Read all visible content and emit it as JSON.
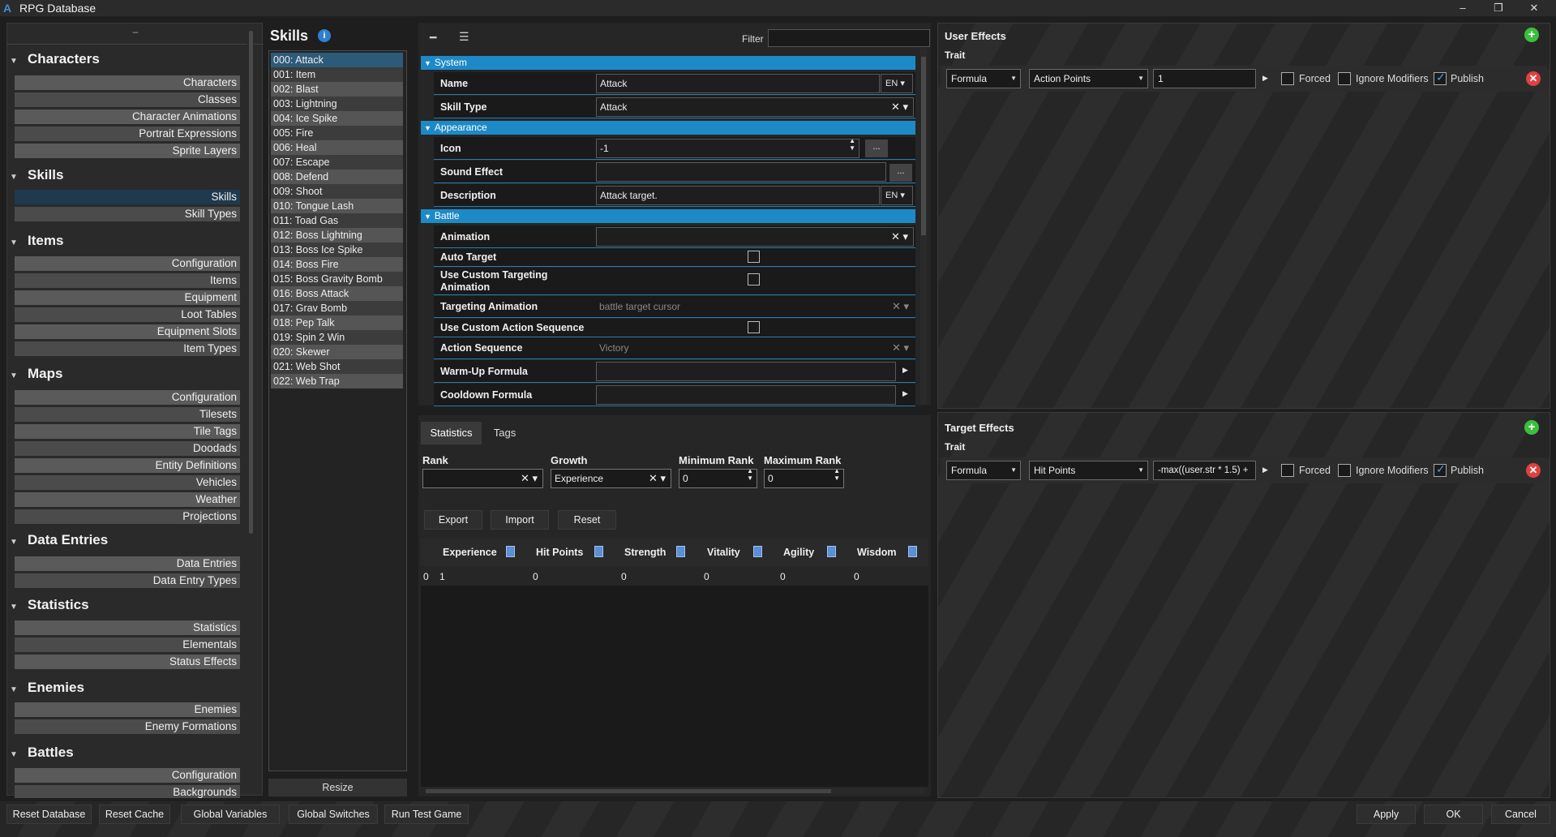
{
  "window": {
    "title": "RPG Database",
    "min": "–",
    "max": "❐",
    "close": "✕"
  },
  "nav": {
    "collapse": "–",
    "categories": [
      {
        "name": "Characters",
        "items": [
          "Characters",
          "Classes",
          "Character Animations",
          "Portrait Expressions",
          "Sprite Layers"
        ]
      },
      {
        "name": "Skills",
        "items": [
          "Skills",
          "Skill Types"
        ]
      },
      {
        "name": "Items",
        "items": [
          "Configuration",
          "Items",
          "Equipment",
          "Loot Tables",
          "Equipment Slots",
          "Item Types"
        ]
      },
      {
        "name": "Maps",
        "items": [
          "Configuration",
          "Tilesets",
          "Tile Tags",
          "Doodads",
          "Entity Definitions",
          "Vehicles",
          "Weather",
          "Projections"
        ]
      },
      {
        "name": "Data Entries",
        "items": [
          "Data Entries",
          "Data Entry Types"
        ]
      },
      {
        "name": "Statistics",
        "items": [
          "Statistics",
          "Elementals",
          "Status Effects"
        ]
      },
      {
        "name": "Enemies",
        "items": [
          "Enemies",
          "Enemy Formations"
        ]
      },
      {
        "name": "Battles",
        "items": [
          "Configuration",
          "Backgrounds"
        ]
      }
    ]
  },
  "skills": {
    "title": "Skills",
    "info": "i",
    "resize": "Resize",
    "list": [
      "000: Attack",
      "001: Item",
      "002: Blast",
      "003: Lightning",
      "004: Ice Spike",
      "005: Fire",
      "006: Heal",
      "007: Escape",
      "008: Defend",
      "009: Shoot",
      "010: Tongue Lash",
      "011: Toad Gas",
      "012: Boss Lightning",
      "013: Boss Ice Spike",
      "014: Boss Fire",
      "015: Boss Gravity Bomb",
      "016: Boss Attack",
      "017: Grav Bomb",
      "018: Pep Talk",
      "019: Spin 2 Win",
      "020: Skewer",
      "021: Web Shot",
      "022: Web Trap"
    ]
  },
  "props": {
    "filter_label": "Filter",
    "sections": {
      "system": "System",
      "appearance": "Appearance",
      "battle": "Battle"
    },
    "name_label": "Name",
    "name_value": "Attack",
    "lang": "EN",
    "skilltype_label": "Skill Type",
    "skilltype_value": "Attack",
    "icon_label": "Icon",
    "icon_value": "-1",
    "sound_label": "Sound Effect",
    "desc_label": "Description",
    "desc_value": "Attack target.",
    "anim_label": "Animation",
    "autotarget_label": "Auto Target",
    "customtarget_label": "Use Custom Targeting Animation",
    "targetanim_label": "Targeting Animation",
    "targetanim_value": "battle target cursor",
    "customseq_label": "Use Custom Action Sequence",
    "actionseq_label": "Action Sequence",
    "actionseq_value": "Victory",
    "warmup_label": "Warm-Up Formula",
    "cooldown_label": "Cooldown Formula",
    "dots": "..."
  },
  "stats": {
    "tabs": [
      "Statistics",
      "Tags"
    ],
    "rank_label": "Rank",
    "growth_label": "Growth",
    "growth_value": "Experience",
    "minrank_label": "Minimum Rank",
    "minrank_value": "0",
    "maxrank_label": "Maximum Rank",
    "maxrank_value": "0",
    "export": "Export",
    "import": "Import",
    "reset": "Reset",
    "columns": [
      "Experience",
      "Hit Points",
      "Strength",
      "Vitality",
      "Agility",
      "Wisdom"
    ],
    "row": {
      "index": "0",
      "values": [
        "1",
        "0",
        "0",
        "0",
        "0",
        "0"
      ]
    }
  },
  "user_effects": {
    "title": "User Effects",
    "trait": "Trait",
    "type": "Formula",
    "target": "Action Points",
    "value": "1",
    "forced": "Forced",
    "ignore": "Ignore Modifiers",
    "publish": "Publish"
  },
  "target_effects": {
    "title": "Target Effects",
    "trait": "Trait",
    "type": "Formula",
    "target": "Hit Points",
    "value": "-max((user.str * 1.5) +",
    "forced": "Forced",
    "ignore": "Ignore Modifiers",
    "publish": "Publish"
  },
  "footer": {
    "reset_db": "Reset Database",
    "reset_cache": "Reset Cache",
    "global_vars": "Global Variables",
    "global_switches": "Global Switches",
    "run_test": "Run Test Game",
    "apply": "Apply",
    "ok": "OK",
    "cancel": "Cancel"
  }
}
